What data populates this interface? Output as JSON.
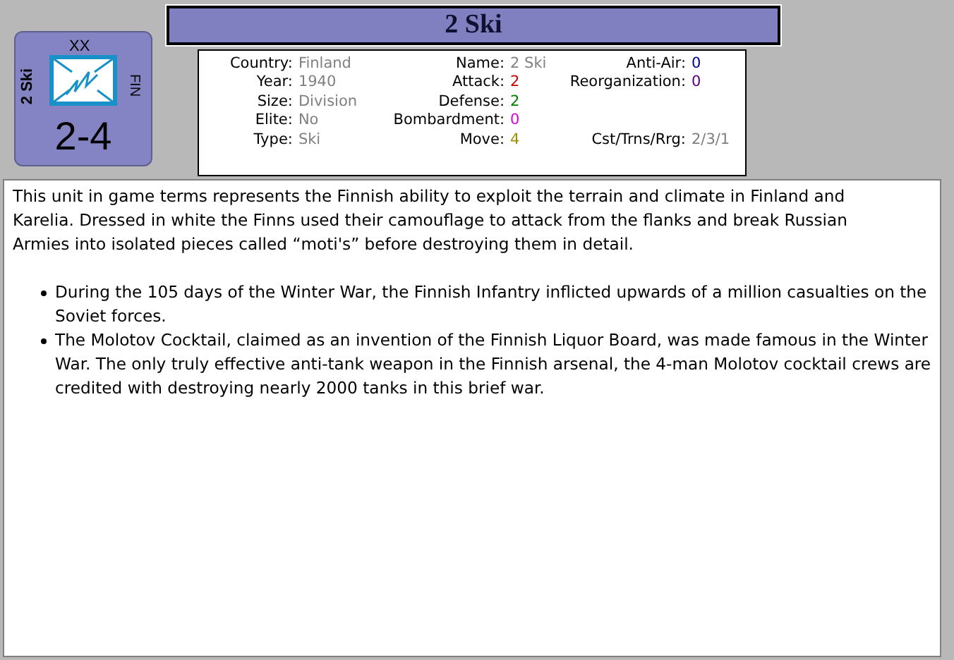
{
  "counter": {
    "size_mark": "XX",
    "unit": "2 Ski",
    "nation": "FIN",
    "strength": "2-4"
  },
  "title": "2 Ski",
  "stats_left": [
    {
      "label": "Country:",
      "value": "Finland",
      "color": "#808080"
    },
    {
      "label": "Year:",
      "value": "1940",
      "color": "#808080"
    },
    {
      "label": "Size:",
      "value": "Division",
      "color": "#808080"
    },
    {
      "label": "Elite:",
      "value": "No",
      "color": "#808080"
    },
    {
      "label": "Type:",
      "value": "Ski",
      "color": "#808080"
    }
  ],
  "stats_middle": [
    {
      "label": "Name:",
      "value": "2 Ski",
      "color": "#808080"
    },
    {
      "label": "Attack:",
      "value": "2",
      "color": "#d00000"
    },
    {
      "label": "Defense:",
      "value": "2",
      "color": "#008000"
    },
    {
      "label": "Bombardment:",
      "value": "0",
      "color": "#e000e0"
    },
    {
      "label": "Move:",
      "value": "4",
      "color": "#a09000"
    }
  ],
  "stats_right": [
    {
      "label": "Anti-Air:",
      "value": "0",
      "color": "#0000a0"
    },
    {
      "label": "Reorganization:",
      "value": "0",
      "color": "#600080"
    },
    {
      "label": "Cst/Trns/Rrg:",
      "value": "2/3/1",
      "color": "#808080"
    }
  ],
  "description": "This unit in game terms represents the Finnish ability to exploit the terrain and climate in Finland and Karelia.  Dressed in white the Finns used their camouflage to attack from the flanks and break Russian Armies into isolated pieces called “moti's” before destroying them in detail.",
  "bullets": [
    "During the 105 days of the Winter War, the Finnish Infantry inflicted upwards of a million casualties on the Soviet forces.",
    "The Molotov Cocktail, claimed as an invention of the Finnish Liquor Board, was made famous in the Winter War.  The only truly effective anti-tank weapon in the Finnish arsenal, the 4-man Molotov cocktail crews are credited with destroying nearly 2000 tanks in this brief war."
  ]
}
